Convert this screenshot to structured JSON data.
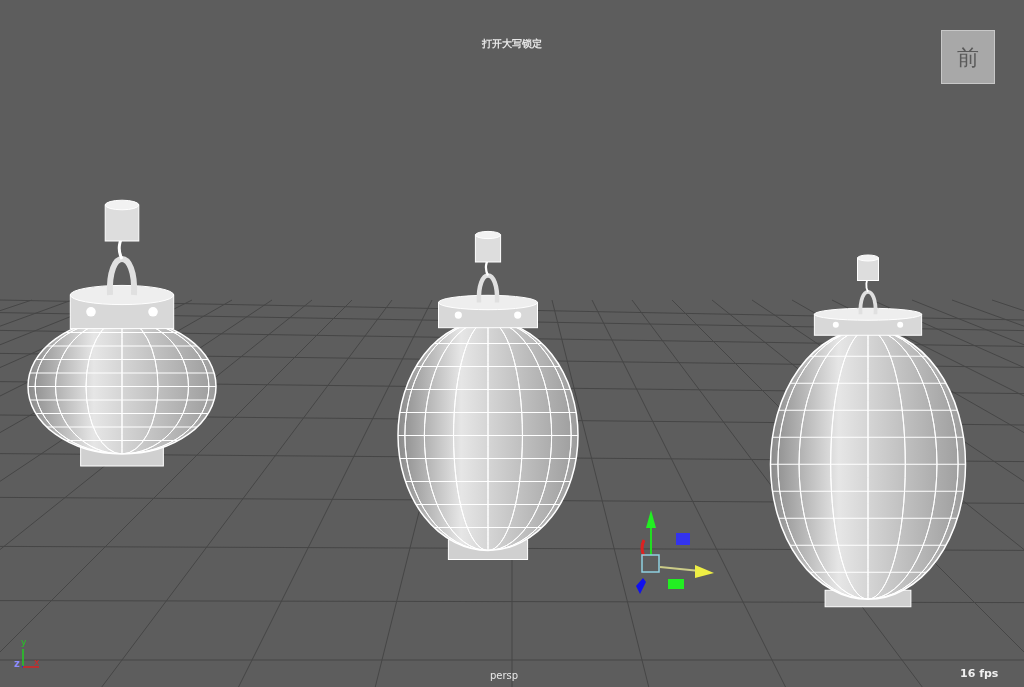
{
  "viewport": {
    "hud_message": "打开大写锁定",
    "view_cube_face": "前",
    "camera_name": "persp",
    "frame_rate": "16 fps"
  },
  "axis_labels": [
    "y",
    "z",
    "x"
  ]
}
